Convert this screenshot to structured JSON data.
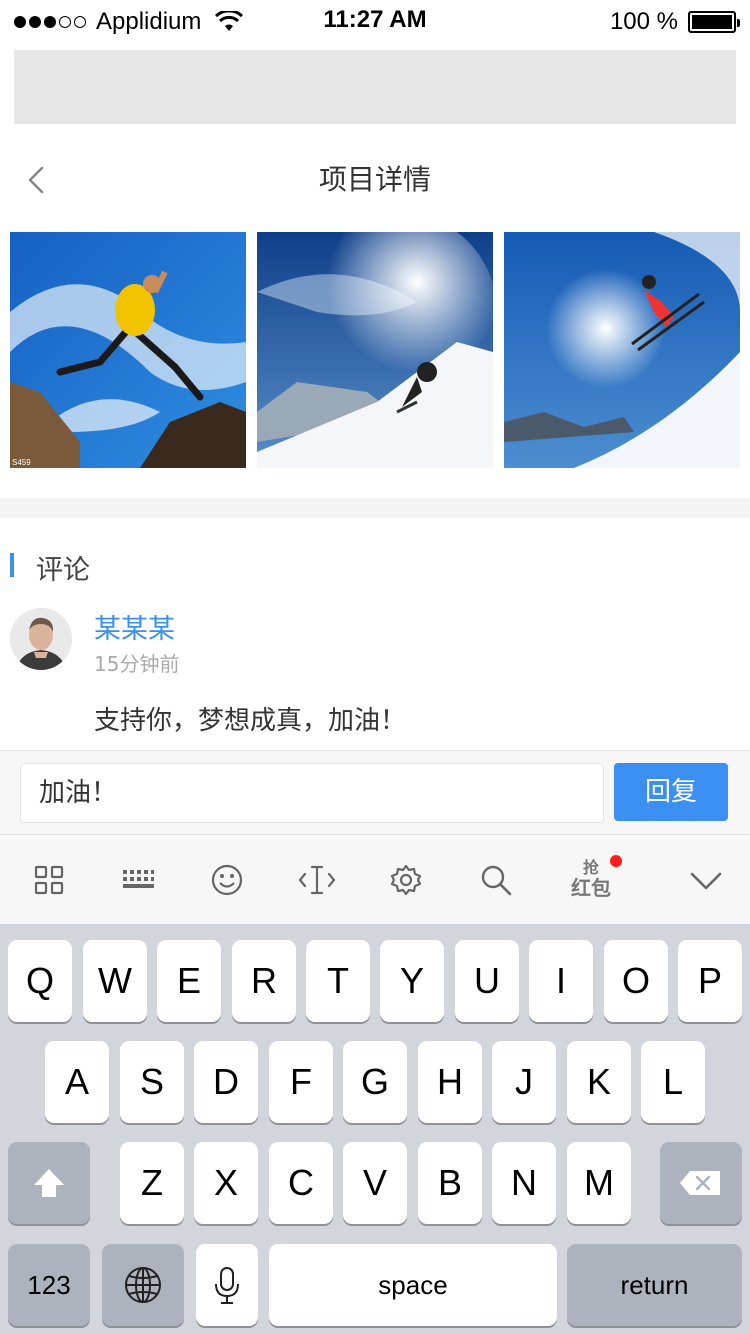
{
  "status_bar": {
    "carrier": "Applidium",
    "time": "11:27 AM",
    "battery": "100 %"
  },
  "nav": {
    "title": "项目详情"
  },
  "photos": [
    {
      "subject": "climber-jumping-image",
      "caption": "S459"
    },
    {
      "subject": "skier-snow-spray-image"
    },
    {
      "subject": "skier-jumping-image"
    }
  ],
  "comments_section": {
    "title": "评论",
    "items": [
      {
        "name": "某某某",
        "time": "15分钟前",
        "text": "支持你，梦想成真，加油！"
      }
    ]
  },
  "reply": {
    "input_value": "加油！",
    "button_label": "回复"
  },
  "toolbar": {
    "icons": [
      "grid-icon",
      "keyboard-icon",
      "emoji-icon",
      "cursor-icon",
      "settings-icon",
      "search-icon",
      "red-packet-icon",
      "chevron-down-icon"
    ],
    "red_packet_label_top": "抢",
    "red_packet_label_bottom": "红包"
  },
  "keyboard": {
    "row1": [
      "Q",
      "W",
      "E",
      "R",
      "T",
      "Y",
      "U",
      "I",
      "O",
      "P"
    ],
    "row2": [
      "A",
      "S",
      "D",
      "F",
      "G",
      "H",
      "J",
      "K",
      "L"
    ],
    "row3": [
      "Z",
      "X",
      "C",
      "V",
      "B",
      "N",
      "M"
    ],
    "numbers_label": "123",
    "space_label": "space",
    "return_label": "return"
  },
  "colors": {
    "accent": "#3b8ff0",
    "badge": "#ff1e1e",
    "keyboard_bg": "#d2d5db"
  }
}
